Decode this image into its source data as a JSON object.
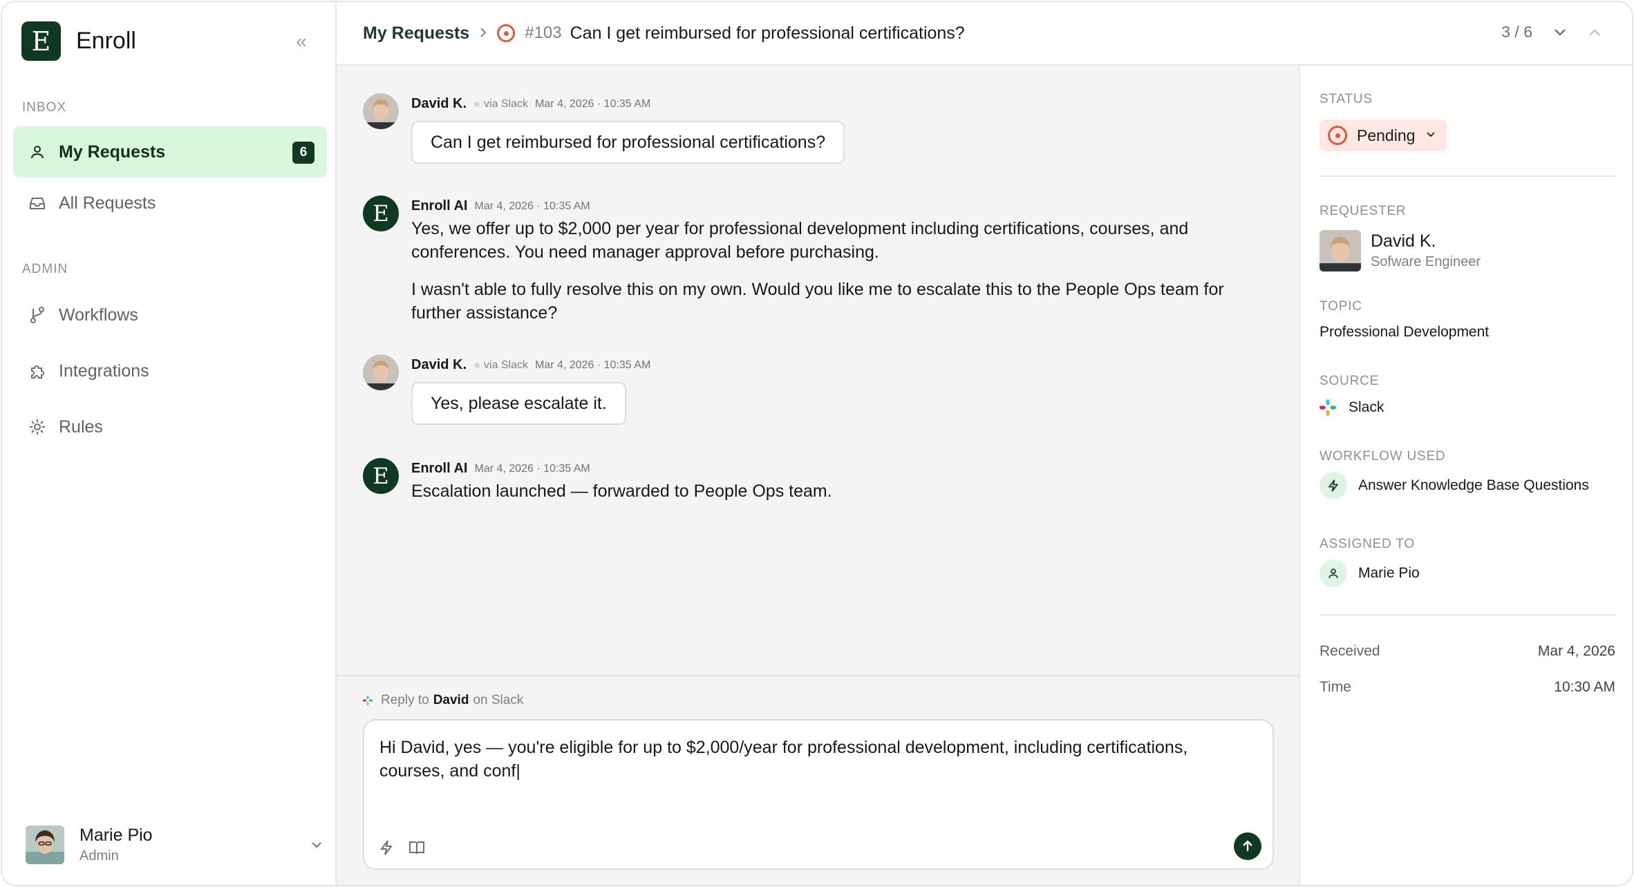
{
  "app": {
    "name": "Enroll",
    "logo_letter": "E"
  },
  "sidebar": {
    "sections": [
      {
        "label": "INBOX"
      },
      {
        "label": "ADMIN"
      }
    ],
    "items": [
      {
        "label": "My Requests",
        "icon": "user-icon",
        "badge": "6",
        "active": true
      },
      {
        "label": "All Requests",
        "icon": "inbox-icon"
      },
      {
        "label": "Workflows",
        "icon": "branch-icon"
      },
      {
        "label": "Integrations",
        "icon": "puzzle-icon"
      },
      {
        "label": "Rules",
        "icon": "gear-icon"
      }
    ],
    "user": {
      "name": "Marie Pio",
      "role": "Admin"
    }
  },
  "header": {
    "breadcrumb_root": "My Requests",
    "ticket_id": "#103",
    "ticket_title": "Can I get reimbursed for professional certifications?",
    "pager": "3 / 6"
  },
  "messages": [
    {
      "author": "David K.",
      "via": "via Slack",
      "time": "Mar 4, 2026 · 10:35 AM",
      "text": "Can I get reimbursed for professional certifications?"
    },
    {
      "author": "Enroll AI",
      "time": "Mar 4, 2026 · 10:35 AM",
      "paragraphs": [
        "Yes, we offer up to $2,000 per year for professional development including certifications, courses, and conferences. You need manager approval before purchasing.",
        "I wasn't able to fully resolve this on my own. Would you like me to escalate this to the People Ops team for further assistance?"
      ]
    },
    {
      "author": "David K.",
      "via": "via Slack",
      "time": "Mar 4, 2026 · 10:35 AM",
      "text": "Yes, please escalate it."
    },
    {
      "author": "Enroll AI",
      "time": "Mar 4, 2026 · 10:35 AM",
      "paragraphs": [
        "Escalation launched — forwarded to People Ops team."
      ]
    }
  ],
  "composer": {
    "reply_prefix": "Reply to",
    "reply_name": "David",
    "reply_suffix": "on Slack",
    "draft": "Hi David, yes — you're eligible for up to $2,000/year for professional development, including certifications, courses, and conf|"
  },
  "details": {
    "status_label": "STATUS",
    "status_value": "Pending",
    "requester_label": "REQUESTER",
    "requester_name": "David K.",
    "requester_role": "Sofware Engineer",
    "topic_label": "TOPIC",
    "topic_value": "Professional Development",
    "source_label": "SOURCE",
    "source_value": "Slack",
    "workflow_label": "WORKFLOW USED",
    "workflow_value": "Answer Knowledge Base Questions",
    "assigned_label": "ASSIGNED TO",
    "assigned_value": "Marie Pio",
    "received_label": "Received",
    "received_value": "Mar 4, 2026",
    "time_label": "Time",
    "time_value": "10:30 AM"
  },
  "colors": {
    "brand": "#0f3a21",
    "active_bg": "#d8f7dc",
    "status": "#e5583c",
    "status_bg": "#fde9e2"
  }
}
